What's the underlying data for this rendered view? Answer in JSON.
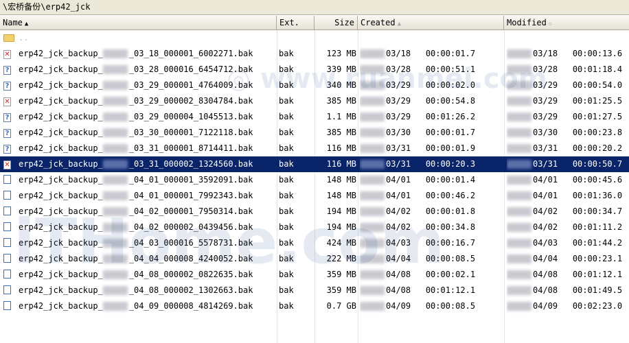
{
  "path": "\\宏桥备份\\erp42_jck",
  "columns": {
    "name": "Name",
    "ext": "Ext.",
    "size": "Size",
    "created": "Created",
    "modified": "Modified"
  },
  "parent_label": "..",
  "rows": [
    {
      "icon": "missing-file-icon",
      "name_prefix": "erp42_jck_backup_",
      "name_suffix": "_03_18_000001_6002271.bak",
      "ext": "bak",
      "size": "123 MB",
      "created_date": "03/18",
      "created_time": "00:00:01.7",
      "modified_date": "03/18",
      "modified_time": "00:00:13.6",
      "selected": false
    },
    {
      "icon": "unknown-file-icon",
      "name_prefix": "erp42_jck_backup_",
      "name_suffix": "_03_28_000016_6454712.bak",
      "ext": "bak",
      "size": "339 MB",
      "created_date": "03/28",
      "created_time": "00:00:51.1",
      "modified_date": "03/28",
      "modified_time": "00:01:18.4",
      "selected": false
    },
    {
      "icon": "unknown-file-icon",
      "name_prefix": "erp42_jck_backup_",
      "name_suffix": "_03_29_000001_4764009.bak",
      "ext": "bak",
      "size": "340 MB",
      "created_date": "03/29",
      "created_time": "00:00:02.0",
      "modified_date": "03/29",
      "modified_time": "00:00:54.0",
      "selected": false
    },
    {
      "icon": "missing-file-icon",
      "name_prefix": "erp42_jck_backup_",
      "name_suffix": "_03_29_000002_8304784.bak",
      "ext": "bak",
      "size": "385 MB",
      "created_date": "03/29",
      "created_time": "00:00:54.8",
      "modified_date": "03/29",
      "modified_time": "00:01:25.5",
      "selected": false
    },
    {
      "icon": "unknown-file-icon",
      "name_prefix": "erp42_jck_backup_",
      "name_suffix": "_03_29_000004_1045513.bak",
      "ext": "bak",
      "size": "1.1 MB",
      "created_date": "03/29",
      "created_time": "00:01:26.2",
      "modified_date": "03/29",
      "modified_time": "00:01:27.5",
      "selected": false
    },
    {
      "icon": "unknown-file-icon",
      "name_prefix": "erp42_jck_backup_",
      "name_suffix": "_03_30_000001_7122118.bak",
      "ext": "bak",
      "size": "385 MB",
      "created_date": "03/30",
      "created_time": "00:00:01.7",
      "modified_date": "03/30",
      "modified_time": "00:00:23.8",
      "selected": false
    },
    {
      "icon": "unknown-file-icon",
      "name_prefix": "erp42_jck_backup_",
      "name_suffix": "_03_31_000001_8714411.bak",
      "ext": "bak",
      "size": "116 MB",
      "created_date": "03/31",
      "created_time": "00:00:01.9",
      "modified_date": "03/31",
      "modified_time": "00:00:20.2",
      "selected": false
    },
    {
      "icon": "missing-file-icon",
      "name_prefix": "erp42_jck_backup_",
      "name_suffix": "_03_31_000002_1324560.bak",
      "ext": "bak",
      "size": "116 MB",
      "created_date": "03/31",
      "created_time": "00:00:20.3",
      "modified_date": "03/31",
      "modified_time": "00:00:50.7",
      "selected": true
    },
    {
      "icon": "document-icon",
      "name_prefix": "erp42_jck_backup_",
      "name_suffix": "_04_01_000001_3592091.bak",
      "ext": "bak",
      "size": "148 MB",
      "created_date": "04/01",
      "created_time": "00:00:01.4",
      "modified_date": "04/01",
      "modified_time": "00:00:45.6",
      "selected": false
    },
    {
      "icon": "document-icon",
      "name_prefix": "erp42_jck_backup_",
      "name_suffix": "_04_01_000001_7992343.bak",
      "ext": "bak",
      "size": "148 MB",
      "created_date": "04/01",
      "created_time": "00:00:46.2",
      "modified_date": "04/01",
      "modified_time": "00:01:36.0",
      "selected": false
    },
    {
      "icon": "document-icon",
      "name_prefix": "erp42_jck_backup_",
      "name_suffix": "_04_02_000001_7950314.bak",
      "ext": "bak",
      "size": "194 MB",
      "created_date": "04/02",
      "created_time": "00:00:01.8",
      "modified_date": "04/02",
      "modified_time": "00:00:34.7",
      "selected": false
    },
    {
      "icon": "document-icon",
      "name_prefix": "erp42_jck_backup_",
      "name_suffix": "_04_02_000002_0439456.bak",
      "ext": "bak",
      "size": "194 MB",
      "created_date": "04/02",
      "created_time": "00:00:34.8",
      "modified_date": "04/02",
      "modified_time": "00:01:11.2",
      "selected": false
    },
    {
      "icon": "document-icon",
      "name_prefix": "erp42_jck_backup_",
      "name_suffix": "_04_03_000016_5578731.bak",
      "ext": "bak",
      "size": "424 MB",
      "created_date": "04/03",
      "created_time": "00:00:16.7",
      "modified_date": "04/03",
      "modified_time": "00:01:44.2",
      "selected": false
    },
    {
      "icon": "document-icon",
      "name_prefix": "erp42_jck_backup_",
      "name_suffix": "_04_04_000008_4240052.bak",
      "ext": "bak",
      "size": "222 MB",
      "created_date": "04/04",
      "created_time": "00:00:08.5",
      "modified_date": "04/04",
      "modified_time": "00:00:23.1",
      "selected": false
    },
    {
      "icon": "document-icon",
      "name_prefix": "erp42_jck_backup_",
      "name_suffix": "_04_08_000002_0822635.bak",
      "ext": "bak",
      "size": "359 MB",
      "created_date": "04/08",
      "created_time": "00:00:02.1",
      "modified_date": "04/08",
      "modified_time": "00:01:12.1",
      "selected": false
    },
    {
      "icon": "document-icon",
      "name_prefix": "erp42_jck_backup_",
      "name_suffix": "_04_08_000002_1302663.bak",
      "ext": "bak",
      "size": "359 MB",
      "created_date": "04/08",
      "created_time": "00:01:12.1",
      "modified_date": "04/08",
      "modified_time": "00:01:49.5",
      "selected": false
    },
    {
      "icon": "document-icon",
      "name_prefix": "erp42_jck_backup_",
      "name_suffix": "_04_09_000008_4814269.bak",
      "ext": "bak",
      "size": "0.7 GB",
      "created_date": "04/09",
      "created_time": "00:00:08.5",
      "modified_date": "04/09",
      "modified_time": "00:02:23.0",
      "selected": false
    }
  ],
  "colors": {
    "selection": "#0a246a",
    "header_bg": "#ece9d8"
  }
}
